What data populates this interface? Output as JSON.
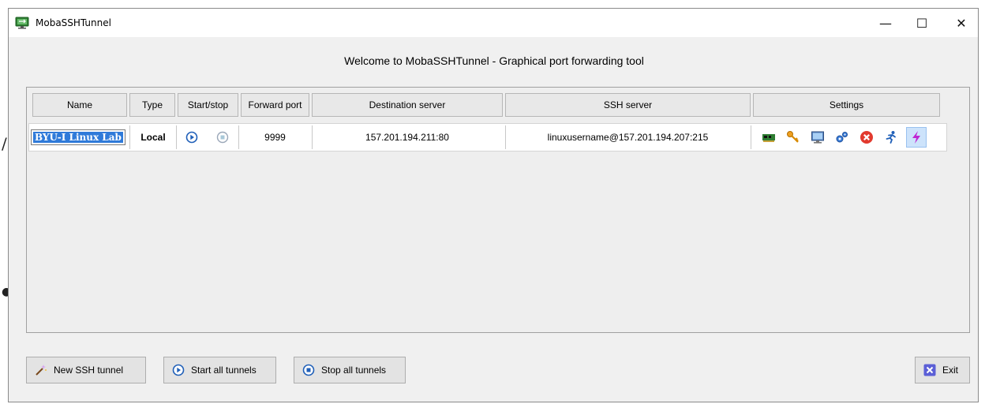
{
  "window": {
    "title": "MobaSSHTunnel",
    "controls": {
      "minimize": "—",
      "maximize": "☐",
      "close": "✕"
    }
  },
  "welcome_text": "Welcome to MobaSSHTunnel - Graphical port forwarding tool",
  "table": {
    "columns": [
      "Name",
      "Type",
      "Start/stop",
      "Forward port",
      "Destination server",
      "SSH server",
      "Settings"
    ],
    "rows": [
      {
        "name": "BYU-I Linux Lab",
        "type": "Local",
        "forward_port": "9999",
        "destination_server": "157.201.194.211:80",
        "ssh_server": "linuxusername@157.201.194.207:215",
        "settings_icons": [
          "network-card-icon",
          "key-icon",
          "monitor-icon",
          "gears-icon",
          "delete-icon",
          "run-icon",
          "lightning-icon"
        ]
      }
    ]
  },
  "buttons": {
    "new_tunnel": "New SSH tunnel",
    "start_all": "Start all tunnels",
    "stop_all": "Stop all tunnels",
    "exit": "Exit"
  },
  "colors": {
    "selection": "#2f7ad9",
    "play": "#1f5fb8",
    "delete": "#e23a2e",
    "lightning": "#c026d3",
    "exit_icon": "#5b5fd6"
  }
}
